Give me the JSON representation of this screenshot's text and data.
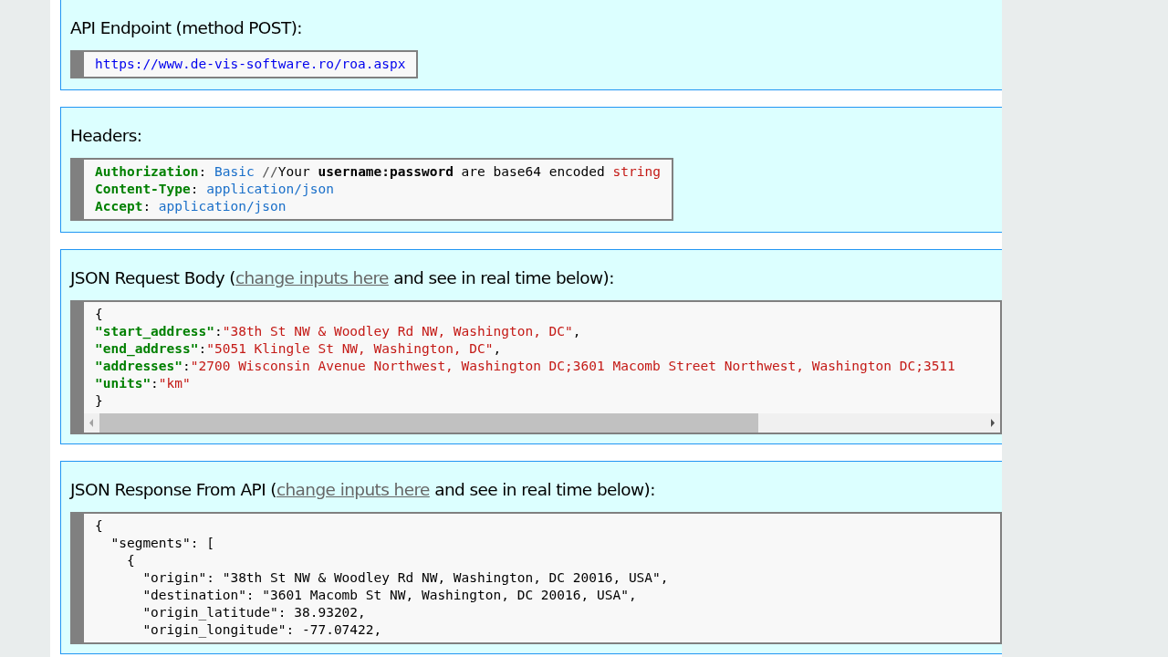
{
  "sections": [
    {
      "heading": {
        "text": "API Endpoint (method POST):"
      },
      "code": {
        "full_width": false,
        "scrollbar": false,
        "lines": [
          [
            {
              "kind": "url",
              "text": "https://www.de-vis-software.ro/roa.aspx"
            }
          ]
        ]
      }
    },
    {
      "heading": {
        "text": "Headers:"
      },
      "code": {
        "full_width": false,
        "scrollbar": false,
        "lines": [
          [
            {
              "kind": "key",
              "text": "Authorization"
            },
            {
              "kind": "plain",
              "text": ": "
            },
            {
              "kind": "value",
              "text": "Basic"
            },
            {
              "kind": "comment",
              "text": " //"
            },
            {
              "kind": "plain",
              "text": "Your "
            },
            {
              "kind": "bold",
              "text": "username:password"
            },
            {
              "kind": "plain",
              "text": " are base64 encoded "
            },
            {
              "kind": "string",
              "text": "string"
            }
          ],
          [
            {
              "kind": "key",
              "text": "Content-Type"
            },
            {
              "kind": "plain",
              "text": ": "
            },
            {
              "kind": "value",
              "text": "application/json"
            }
          ],
          [
            {
              "kind": "key",
              "text": "Accept"
            },
            {
              "kind": "plain",
              "text": ": "
            },
            {
              "kind": "value",
              "text": "application/json"
            }
          ]
        ]
      }
    },
    {
      "heading": {
        "text": "JSON Request Body (",
        "link": "change inputs here",
        "suffix": " and see in real time below):"
      },
      "code": {
        "full_width": true,
        "scrollbar": true,
        "lines": [
          [
            {
              "kind": "plain",
              "text": "{"
            }
          ],
          [
            {
              "kind": "key",
              "text": "\"start_address\""
            },
            {
              "kind": "plain",
              "text": ":"
            },
            {
              "kind": "string",
              "text": "\"38th St NW & Woodley Rd NW, Washington, DC\""
            },
            {
              "kind": "plain",
              "text": ","
            }
          ],
          [
            {
              "kind": "key",
              "text": "\"end_address\""
            },
            {
              "kind": "plain",
              "text": ":"
            },
            {
              "kind": "string",
              "text": "\"5051 Klingle St NW, Washington, DC\""
            },
            {
              "kind": "plain",
              "text": ","
            }
          ],
          [
            {
              "kind": "key",
              "text": "\"addresses\""
            },
            {
              "kind": "plain",
              "text": ":"
            },
            {
              "kind": "string",
              "text": "\"2700 Wisconsin Avenue Northwest, Washington DC;3601 Macomb Street Northwest, Washington DC;3511"
            }
          ],
          [
            {
              "kind": "key",
              "text": "\"units\""
            },
            {
              "kind": "plain",
              "text": ":"
            },
            {
              "kind": "string",
              "text": "\"km\""
            }
          ],
          [
            {
              "kind": "plain",
              "text": "}"
            }
          ]
        ]
      }
    },
    {
      "heading": {
        "text": "JSON Response From API (",
        "link": "change inputs here",
        "suffix": " and see in real time below):"
      },
      "code": {
        "full_width": true,
        "scrollbar": false,
        "lines": [
          [
            {
              "kind": "plain",
              "text": "{"
            }
          ],
          [
            {
              "kind": "plain",
              "text": "  \"segments\": ["
            }
          ],
          [
            {
              "kind": "plain",
              "text": "    {"
            }
          ],
          [
            {
              "kind": "plain",
              "text": "      \"origin\": \"38th St NW & Woodley Rd NW, Washington, DC 20016, USA\","
            }
          ],
          [
            {
              "kind": "plain",
              "text": "      \"destination\": \"3601 Macomb St NW, Washington, DC 20016, USA\","
            }
          ],
          [
            {
              "kind": "plain",
              "text": "      \"origin_latitude\": 38.93202,"
            }
          ],
          [
            {
              "kind": "plain",
              "text": "      \"origin_longitude\": -77.07422,"
            }
          ]
        ]
      }
    }
  ]
}
